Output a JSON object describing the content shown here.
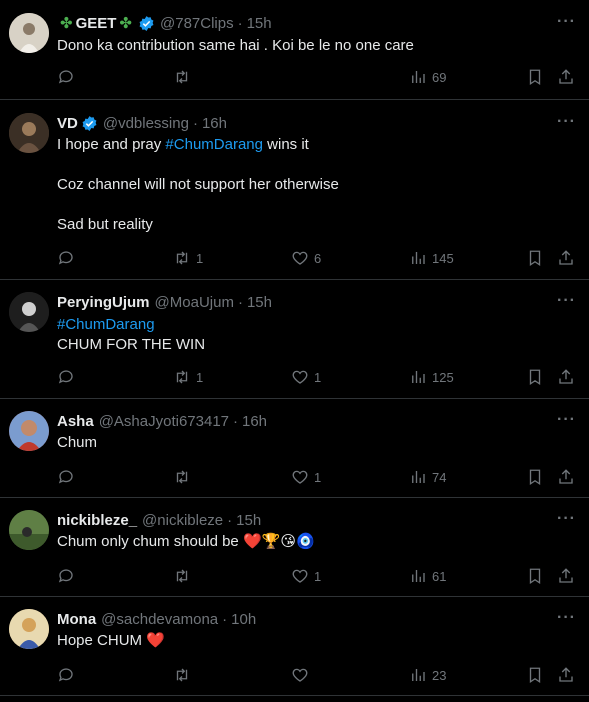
{
  "tweets": [
    {
      "name": "GEET",
      "name_decorations": "clover",
      "handle": "@787Clips",
      "time": "15h",
      "verified": true,
      "lines": [
        "Dono ka contribution same hai . Koi be le no one care"
      ],
      "replies": "",
      "retweets": "",
      "likes": "",
      "views": "69",
      "avatar_color": "#c9c2b5"
    },
    {
      "name": "VD",
      "handle": "@vdblessing",
      "time": "16h",
      "verified": true,
      "line1_prefix": "I hope and pray ",
      "line1_hashtag": "#ChumDarang",
      "line1_suffix": " wins it",
      "line2": "Coz channel will not support her otherwise",
      "line3": "Sad but reality",
      "replies": "",
      "retweets": "1",
      "likes": "6",
      "views": "145",
      "avatar_color": "#5a4a3a"
    },
    {
      "name": "PeryingUjum",
      "handle": "@MoaUjum",
      "time": "15h",
      "verified": false,
      "hashtag": "#ChumDarang",
      "line2": "CHUM FOR THE WIN",
      "replies": "",
      "retweets": "1",
      "likes": "1",
      "views": "125",
      "avatar_color": "#2a2a2a"
    },
    {
      "name": "Asha",
      "handle": "@AshaJyoti673417",
      "time": "16h",
      "verified": false,
      "line1": "Chum",
      "replies": "",
      "retweets": "",
      "likes": "1",
      "views": "74",
      "avatar_color": "#b55a4a"
    },
    {
      "name": "nickibleze_",
      "handle": "@nickibleze",
      "time": "15h",
      "verified": false,
      "line1": "Chum only chum should be",
      "emojis": [
        "❤️",
        "🏆",
        "😘",
        "🧿"
      ],
      "replies": "",
      "retweets": "",
      "likes": "1",
      "views": "61",
      "avatar_color": "#4a6a3a"
    },
    {
      "name": "Mona",
      "handle": "@sachdevamona",
      "time": "10h",
      "verified": false,
      "line1": "Hope CHUM",
      "emoji": "❤️",
      "replies": "",
      "retweets": "",
      "likes": "",
      "views": "23",
      "avatar_color": "#c9a96a"
    }
  ],
  "more_glyph": "···",
  "separator": "·",
  "clover_glyph": "✤",
  "colors": {
    "background": "#000000",
    "text": "#e7e9ea",
    "muted": "#71767b",
    "link": "#1d9bf0",
    "verified": "#1d9bf0",
    "divider": "#2f3336"
  }
}
